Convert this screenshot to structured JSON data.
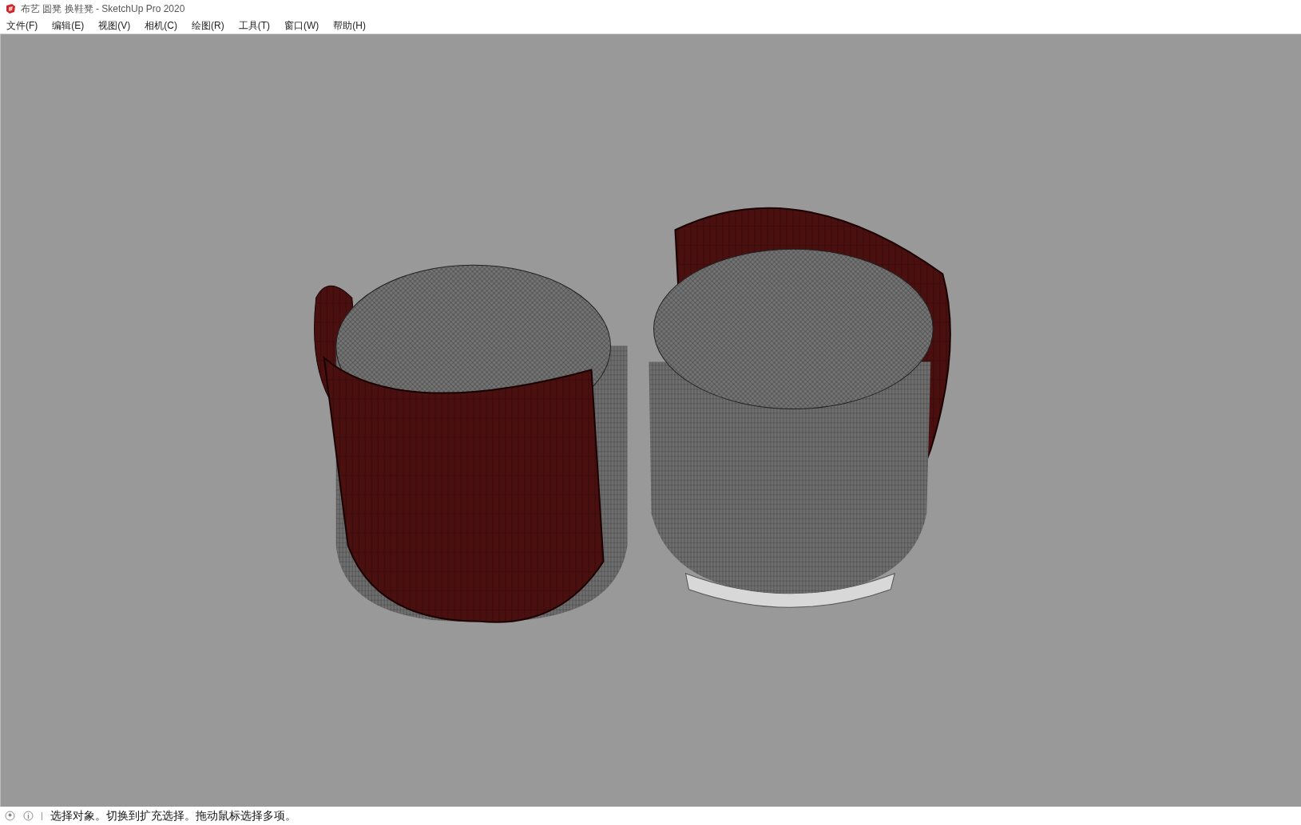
{
  "window": {
    "title": "布艺 圆凳 换鞋凳 - SketchUp Pro 2020"
  },
  "menu": [
    "文件(F)",
    "编辑(E)",
    "视图(V)",
    "相机(C)",
    "绘图(R)",
    "工具(T)",
    "窗口(W)",
    "帮助(H)"
  ],
  "status_bar": {
    "message": "选择对象。切换到扩充选择。拖动鼠标选择多项。"
  }
}
